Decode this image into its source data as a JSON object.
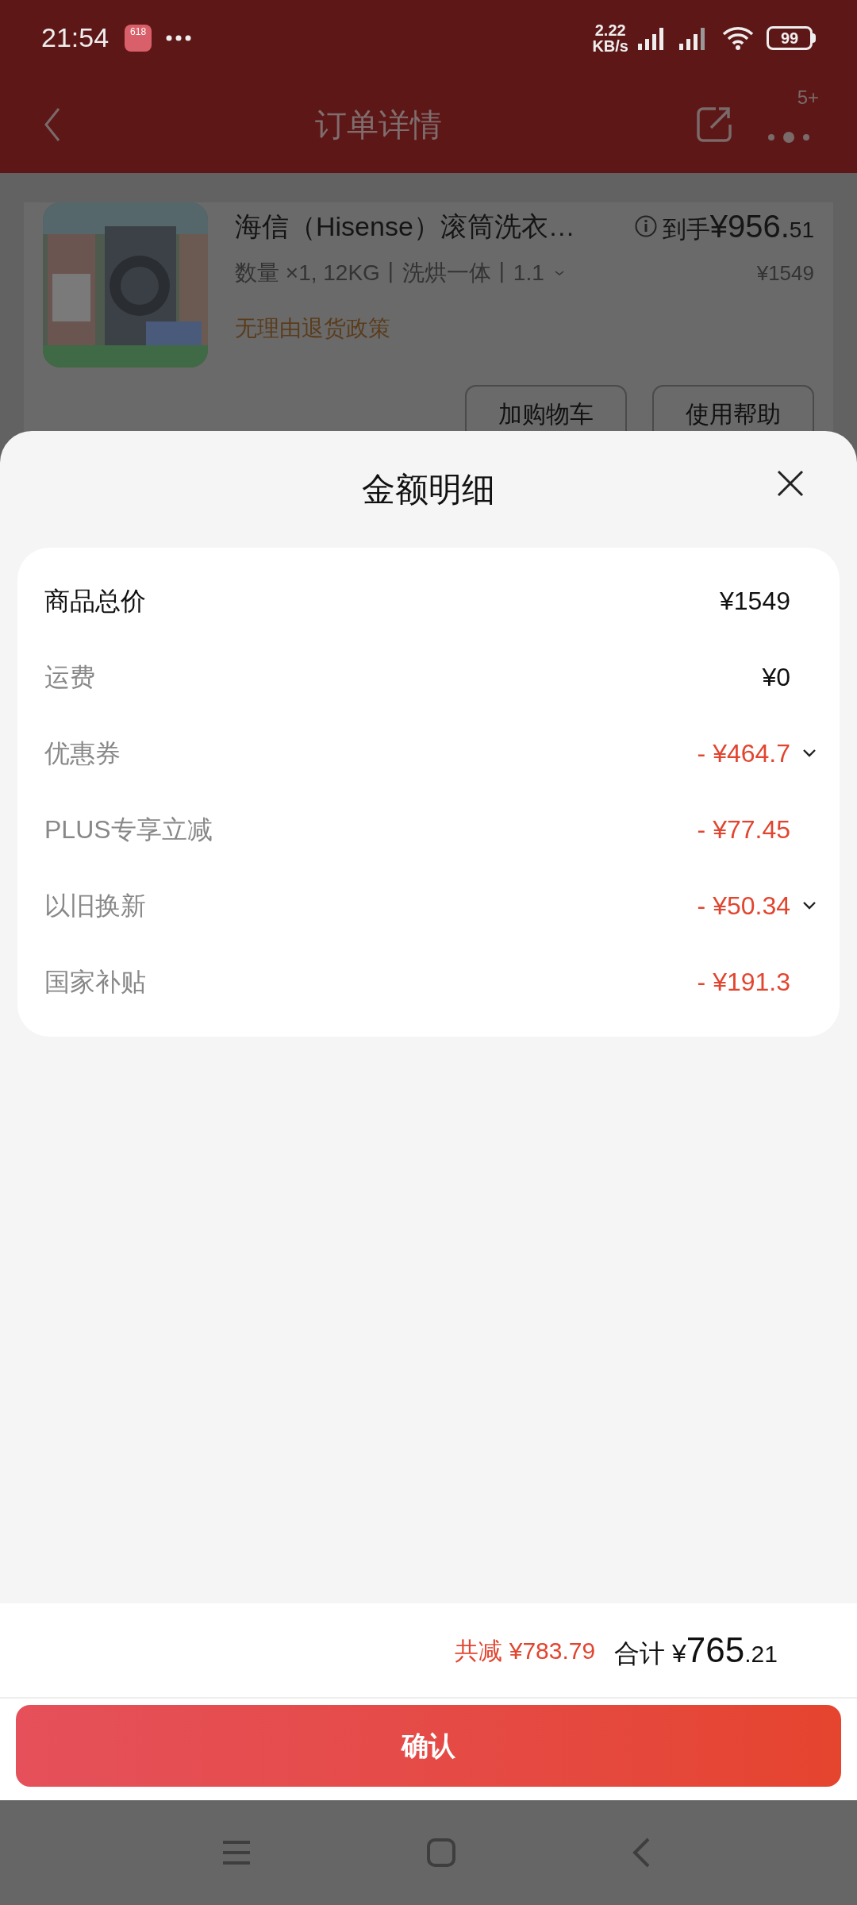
{
  "status_bar": {
    "time": "21:54",
    "app_badge": "618",
    "speed": "2.22",
    "speed_unit": "KB/s",
    "battery": "99"
  },
  "header": {
    "title": "订单详情",
    "badge": "5+"
  },
  "product": {
    "name": "海信（Hisense）滚筒洗衣…",
    "spec": "数量 ×1, 12KG丨洗烘一体丨1.1",
    "price_label": "到手",
    "price_main": "¥956.",
    "price_cents": "51",
    "original_price": "¥1549",
    "policy": "无理由退货政策",
    "buttons": [
      "加购物车",
      "使用帮助"
    ]
  },
  "sheet": {
    "title": "金额明细",
    "rows": [
      {
        "label": "商品总价",
        "amount": "¥1549",
        "kind": "total",
        "expandable": false
      },
      {
        "label": "运费",
        "amount": "¥0",
        "kind": "charge",
        "expandable": false
      },
      {
        "label": "优惠券",
        "amount": "- ¥464.7",
        "kind": "discount",
        "expandable": true
      },
      {
        "label": "PLUS专享立减",
        "amount": "- ¥77.45",
        "kind": "discount",
        "expandable": false
      },
      {
        "label": "以旧换新",
        "amount": "- ¥50.34",
        "kind": "discount",
        "expandable": true
      },
      {
        "label": "国家补贴",
        "amount": "- ¥191.3",
        "kind": "discount",
        "expandable": false
      }
    ]
  },
  "footer": {
    "saved": "共减 ¥783.79",
    "total_label": "合计 ¥",
    "total_main": "765",
    "total_cents": ".21",
    "confirm": "确认"
  }
}
